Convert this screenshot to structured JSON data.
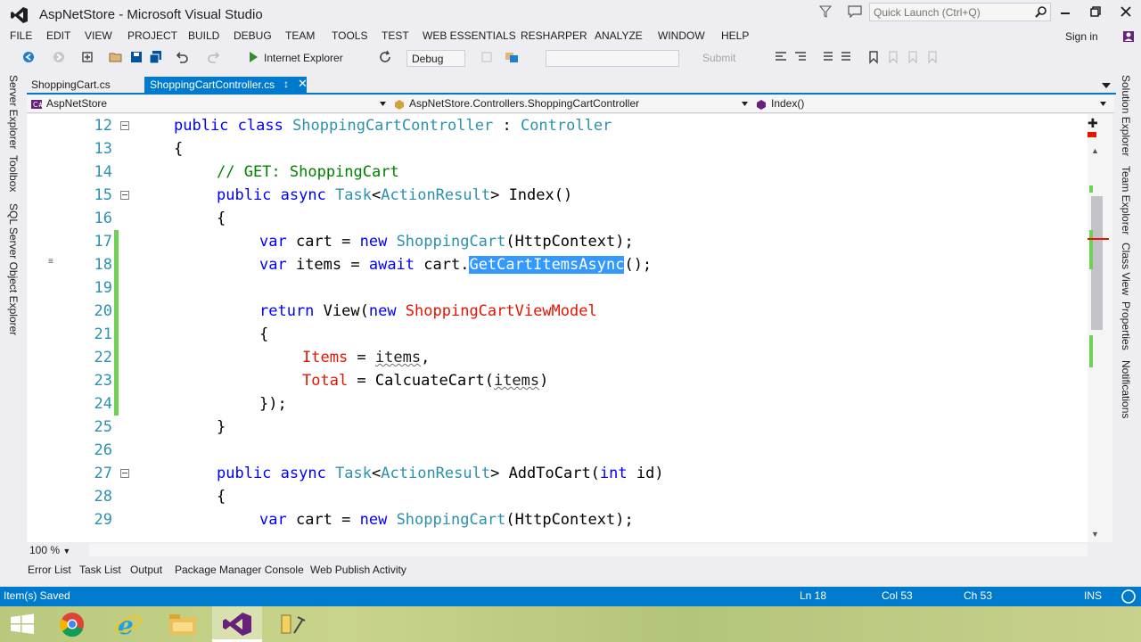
{
  "window": {
    "title": "AspNetStore - Microsoft Visual Studio",
    "quick_launch_placeholder": "Quick Launch (Ctrl+Q)",
    "sign_in": "Sign in"
  },
  "menu": [
    "FILE",
    "EDIT",
    "VIEW",
    "PROJECT",
    "BUILD",
    "DEBUG",
    "TEAM",
    "TOOLS",
    "TEST",
    "WEB ESSENTIALS",
    "RESHARPER",
    "ANALYZE",
    "WINDOW",
    "HELP"
  ],
  "toolbar": {
    "run_target": "Internet Explorer",
    "configuration": "Debug",
    "submit": "Submit"
  },
  "tabs": [
    {
      "label": "ShoppingCart.cs",
      "active": false
    },
    {
      "label": "ShoppingCartController.cs",
      "active": true
    }
  ],
  "navbar": {
    "project": "AspNetStore",
    "class": "AspNetStore.Controllers.ShoppingCartController",
    "member": "Index()"
  },
  "code_lines": [
    {
      "n": "12",
      "tokens": [
        [
          "kw",
          "public class "
        ],
        [
          "ty",
          "ShoppingCartController"
        ],
        [
          "pl",
          " : "
        ],
        [
          "ty",
          "Controller"
        ]
      ],
      "indent": 0,
      "fold": true
    },
    {
      "n": "13",
      "tokens": [
        [
          "pl",
          "{"
        ]
      ],
      "indent": 0
    },
    {
      "n": "14",
      "tokens": [
        [
          "cm",
          "// GET: ShoppingCart"
        ]
      ],
      "indent": 1
    },
    {
      "n": "15",
      "tokens": [
        [
          "kw",
          "public async "
        ],
        [
          "ty",
          "Task"
        ],
        [
          "pl",
          "<"
        ],
        [
          "ty",
          "ActionResult"
        ],
        [
          "pl",
          "> Index()"
        ]
      ],
      "indent": 1,
      "fold": true
    },
    {
      "n": "16",
      "tokens": [
        [
          "pl",
          "{"
        ]
      ],
      "indent": 1
    },
    {
      "n": "17",
      "tokens": [
        [
          "kw",
          "var"
        ],
        [
          "pl",
          " cart = "
        ],
        [
          "kw",
          "new "
        ],
        [
          "ty",
          "ShoppingCart"
        ],
        [
          "pl",
          "(HttpContext);"
        ]
      ],
      "indent": 2
    },
    {
      "n": "18",
      "tokens": [
        [
          "kw",
          "var"
        ],
        [
          "pl",
          " items = "
        ],
        [
          "kw",
          "await"
        ],
        [
          "pl",
          " cart."
        ],
        [
          "sel",
          "GetCartItemsAsync"
        ],
        [
          "pl",
          "();"
        ]
      ],
      "indent": 2
    },
    {
      "n": "19",
      "tokens": [],
      "indent": 2
    },
    {
      "n": "20",
      "tokens": [
        [
          "kw",
          "return "
        ],
        [
          "pl",
          "View("
        ],
        [
          "kw",
          "new "
        ],
        [
          "rd",
          "ShoppingCartViewModel"
        ]
      ],
      "indent": 2
    },
    {
      "n": "21",
      "tokens": [
        [
          "pl",
          "{"
        ]
      ],
      "indent": 2
    },
    {
      "n": "22",
      "tokens": [
        [
          "rd",
          "Items"
        ],
        [
          "pl",
          " = "
        ],
        [
          "squig",
          "items"
        ],
        [
          "pl",
          ","
        ]
      ],
      "indent": 3
    },
    {
      "n": "23",
      "tokens": [
        [
          "rd",
          "Total"
        ],
        [
          "pl",
          " = CalcuateCart("
        ],
        [
          "squig",
          "items"
        ],
        [
          "pl",
          ")"
        ]
      ],
      "indent": 3
    },
    {
      "n": "24",
      "tokens": [
        [
          "pl",
          "});"
        ]
      ],
      "indent": 2
    },
    {
      "n": "25",
      "tokens": [
        [
          "pl",
          "}"
        ]
      ],
      "indent": 1
    },
    {
      "n": "26",
      "tokens": [],
      "indent": 1
    },
    {
      "n": "27",
      "tokens": [
        [
          "kw",
          "public async "
        ],
        [
          "ty",
          "Task"
        ],
        [
          "pl",
          "<"
        ],
        [
          "ty",
          "ActionResult"
        ],
        [
          "pl",
          "> AddToCart("
        ],
        [
          "kw",
          "int"
        ],
        [
          "pl",
          " id)"
        ]
      ],
      "indent": 1,
      "fold": true
    },
    {
      "n": "28",
      "tokens": [
        [
          "pl",
          "{"
        ]
      ],
      "indent": 1
    },
    {
      "n": "29",
      "tokens": [
        [
          "kw",
          "var"
        ],
        [
          "pl",
          " cart = "
        ],
        [
          "kw",
          "new "
        ],
        [
          "ty",
          "ShoppingCart"
        ],
        [
          "pl",
          "(HttpContext);"
        ]
      ],
      "indent": 2
    }
  ],
  "zoom": "100 %",
  "bottom_tabs": [
    "Error List",
    "Task List",
    "Output",
    "Package Manager Console",
    "Web Publish Activity"
  ],
  "left_tabs": [
    "Server Explorer",
    "Toolbox",
    "SQL Server Object Explorer"
  ],
  "right_tabs": [
    "Solution Explorer",
    "Team Explorer",
    "Class View",
    "Properties",
    "Notifications"
  ],
  "status": {
    "message": "Item(s) Saved",
    "line": "Ln 18",
    "col": "Col 53",
    "ch": "Ch 53",
    "mode": "INS"
  },
  "colors": {
    "accent": "#007acc",
    "keyword": "#0000ff",
    "type": "#2b91af",
    "comment": "#008000"
  },
  "taskbar": [
    "start-icon",
    "chrome-icon",
    "internet-explorer-icon",
    "file-explorer-icon",
    "visual-studio-icon",
    "tools-icon"
  ]
}
